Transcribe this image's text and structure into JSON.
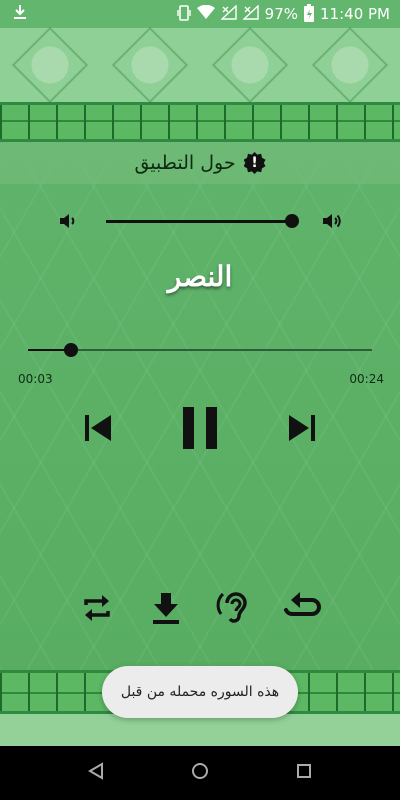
{
  "status_bar": {
    "download_icon": "download-arrow-icon",
    "battery_percent": "97%",
    "time": "11:40 PM",
    "icons": [
      "wifi-icon",
      "signal-x-icon",
      "signal-x-icon",
      "battery-charging-icon"
    ]
  },
  "header": {
    "about_label": "حول التطبيق",
    "about_icon": "info-badge-icon"
  },
  "player": {
    "surah_title": "النصر",
    "volume_level": 0.99,
    "progress_fraction": 0.125,
    "current_time": "00:03",
    "total_time": "00:24",
    "controls": {
      "prev_icon": "skip-previous-icon",
      "pause_icon": "pause-icon",
      "next_icon": "skip-next-icon"
    },
    "actions": {
      "repeat_icon": "repeat-icon",
      "download_icon": "download-icon",
      "listen_icon": "hearing-icon",
      "replay_icon": "replay-icon"
    }
  },
  "toast": {
    "message": "هذه السوره محمله من قبل"
  },
  "colors": {
    "background_green": "#5fb36a",
    "band_green": "#5db864",
    "icon_black": "#111111"
  },
  "nav_bar": {
    "buttons": [
      "back-icon",
      "home-icon",
      "recents-icon"
    ]
  }
}
